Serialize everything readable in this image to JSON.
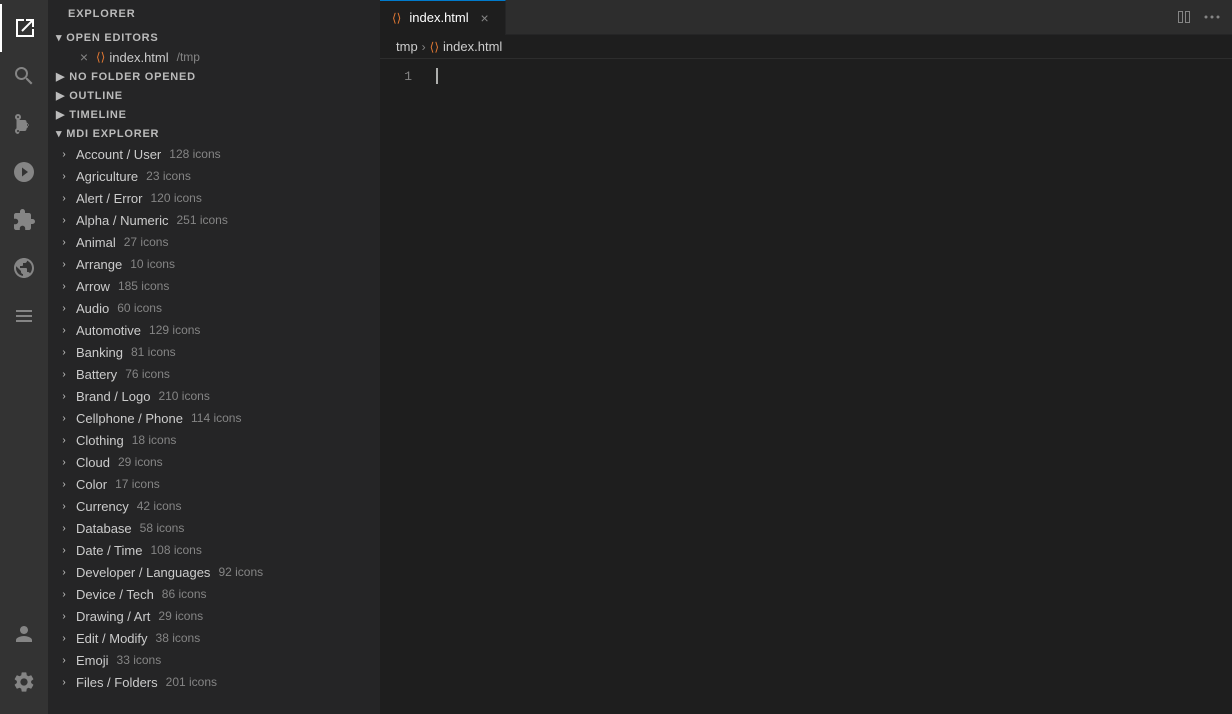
{
  "activityBar": {
    "items": [
      {
        "name": "explorer",
        "label": "Explorer",
        "active": true
      },
      {
        "name": "search",
        "label": "Search"
      },
      {
        "name": "source-control",
        "label": "Source Control"
      },
      {
        "name": "run",
        "label": "Run"
      },
      {
        "name": "extensions",
        "label": "Extensions"
      },
      {
        "name": "remote-explorer",
        "label": "Remote Explorer"
      },
      {
        "name": "icon-pack",
        "label": "Icon Pack"
      }
    ],
    "bottom": [
      {
        "name": "account",
        "label": "Account"
      },
      {
        "name": "settings",
        "label": "Settings"
      }
    ]
  },
  "sidebar": {
    "title": "EXPLORER",
    "sections": [
      {
        "id": "open-editors",
        "label": "OPEN EDITORS",
        "expanded": true,
        "items": [
          {
            "name": "index.html",
            "path": "/tmp",
            "active": true
          }
        ]
      },
      {
        "id": "no-folder",
        "label": "NO FOLDER OPENED",
        "expanded": false
      },
      {
        "id": "outline",
        "label": "OUTLINE",
        "expanded": false
      },
      {
        "id": "timeline",
        "label": "TIMELINE",
        "expanded": false
      },
      {
        "id": "mdi-explorer",
        "label": "MDI EXPLORER",
        "expanded": true,
        "items": [
          {
            "name": "Account / User",
            "count": "128 icons"
          },
          {
            "name": "Agriculture",
            "count": "23 icons"
          },
          {
            "name": "Alert / Error",
            "count": "120 icons"
          },
          {
            "name": "Alpha / Numeric",
            "count": "251 icons"
          },
          {
            "name": "Animal",
            "count": "27 icons"
          },
          {
            "name": "Arrange",
            "count": "10 icons"
          },
          {
            "name": "Arrow",
            "count": "185 icons"
          },
          {
            "name": "Audio",
            "count": "60 icons"
          },
          {
            "name": "Automotive",
            "count": "129 icons"
          },
          {
            "name": "Banking",
            "count": "81 icons"
          },
          {
            "name": "Battery",
            "count": "76 icons"
          },
          {
            "name": "Brand / Logo",
            "count": "210 icons"
          },
          {
            "name": "Cellphone / Phone",
            "count": "114 icons"
          },
          {
            "name": "Clothing",
            "count": "18 icons"
          },
          {
            "name": "Cloud",
            "count": "29 icons"
          },
          {
            "name": "Color",
            "count": "17 icons"
          },
          {
            "name": "Currency",
            "count": "42 icons"
          },
          {
            "name": "Database",
            "count": "58 icons"
          },
          {
            "name": "Date / Time",
            "count": "108 icons"
          },
          {
            "name": "Developer / Languages",
            "count": "92 icons"
          },
          {
            "name": "Device / Tech",
            "count": "86 icons"
          },
          {
            "name": "Drawing / Art",
            "count": "29 icons"
          },
          {
            "name": "Edit / Modify",
            "count": "38 icons"
          },
          {
            "name": "Emoji",
            "count": "33 icons"
          },
          {
            "name": "Files / Folders",
            "count": "201 icons"
          }
        ]
      }
    ]
  },
  "tabs": [
    {
      "label": "index.html",
      "active": true,
      "icon": "html-icon"
    }
  ],
  "breadcrumb": {
    "items": [
      {
        "label": "tmp"
      },
      {
        "label": "index.html",
        "icon": true
      }
    ]
  },
  "editor": {
    "lineNumbers": [
      "1"
    ]
  },
  "tabActions": {
    "split": "⊞",
    "more": "..."
  }
}
